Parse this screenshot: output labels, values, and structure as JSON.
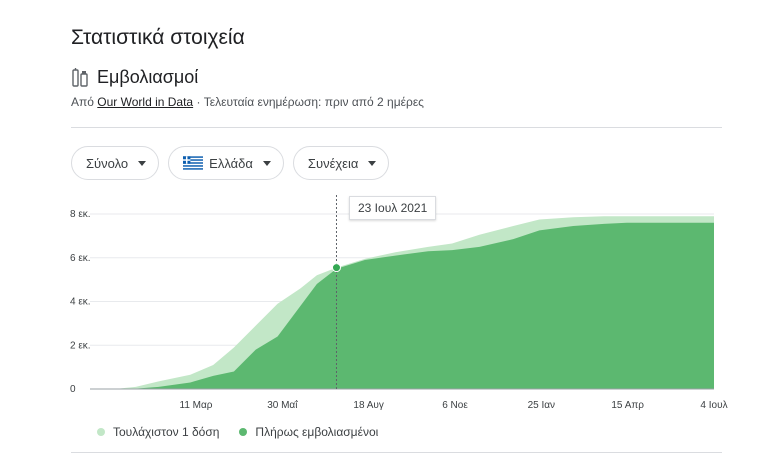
{
  "page": {
    "title": "Στατιστικά στοιχεία",
    "subtitle": "Εμβολιασμοί",
    "source_prefix": "Από ",
    "source_link": "Our World in Data",
    "source_suffix": " · Τελευταία ενημέρωση: πριν από 2 ημέρες"
  },
  "filters": [
    {
      "label": "Σύνολο"
    },
    {
      "label": "Ελλάδα"
    },
    {
      "label": "Συνέχεια"
    }
  ],
  "tooltip": {
    "date": "23 Ιουλ 2021"
  },
  "colors": {
    "at_least_one": "#c2e7c7",
    "fully": "#5cb870",
    "dot": "#34a853"
  },
  "chart_data": {
    "type": "area",
    "title": "",
    "xlabel": "",
    "ylabel": "",
    "x_ticks": [
      "11 Μαρ",
      "30 Μαΐ",
      "18 Αυγ",
      "6 Νοε",
      "25 Ιαν",
      "15 Απρ",
      "4 Ιουλ"
    ],
    "y_ticks": [
      "0",
      "2 εκ.",
      "4 εκ.",
      "6 εκ.",
      "8 εκ."
    ],
    "ylim": [
      0,
      8
    ],
    "y_unit": "εκ.",
    "grid": true,
    "legend_position": "bottom-left",
    "series": [
      {
        "name": "Τουλάχιστον 1 δόση",
        "x": [
          "2021-01-01",
          "2021-01-20",
          "2021-02-10",
          "2021-03-11",
          "2021-04-01",
          "2021-04-20",
          "2021-05-10",
          "2021-05-30",
          "2021-06-20",
          "2021-07-05",
          "2021-07-23",
          "2021-08-18",
          "2021-09-15",
          "2021-10-15",
          "2021-11-06",
          "2021-12-01",
          "2022-01-01",
          "2022-01-25",
          "2022-02-25",
          "2022-03-25",
          "2022-04-15",
          "2022-05-15",
          "2022-06-15",
          "2022-07-04"
        ],
        "values": [
          0.0,
          0.1,
          0.35,
          0.65,
          1.1,
          1.9,
          2.9,
          3.9,
          4.6,
          5.2,
          5.55,
          5.95,
          6.25,
          6.5,
          6.65,
          7.05,
          7.45,
          7.75,
          7.85,
          7.9,
          7.9,
          7.9,
          7.9,
          7.9
        ]
      },
      {
        "name": "Πλήρως εμβολιασμένοι",
        "x": [
          "2021-01-01",
          "2021-01-20",
          "2021-02-10",
          "2021-03-11",
          "2021-04-01",
          "2021-04-20",
          "2021-05-10",
          "2021-05-30",
          "2021-06-20",
          "2021-07-05",
          "2021-07-23",
          "2021-08-18",
          "2021-09-15",
          "2021-10-15",
          "2021-11-06",
          "2021-12-01",
          "2022-01-01",
          "2022-01-25",
          "2022-02-25",
          "2022-03-25",
          "2022-04-15",
          "2022-05-15",
          "2022-06-15",
          "2022-07-04"
        ],
        "values": [
          0.0,
          0.02,
          0.1,
          0.3,
          0.6,
          0.8,
          1.8,
          2.4,
          3.8,
          4.8,
          5.5,
          5.9,
          6.1,
          6.3,
          6.35,
          6.5,
          6.85,
          7.25,
          7.45,
          7.55,
          7.6,
          7.6,
          7.6,
          7.6
        ]
      }
    ],
    "highlight": {
      "x": "2021-07-23",
      "value": 5.55
    }
  }
}
